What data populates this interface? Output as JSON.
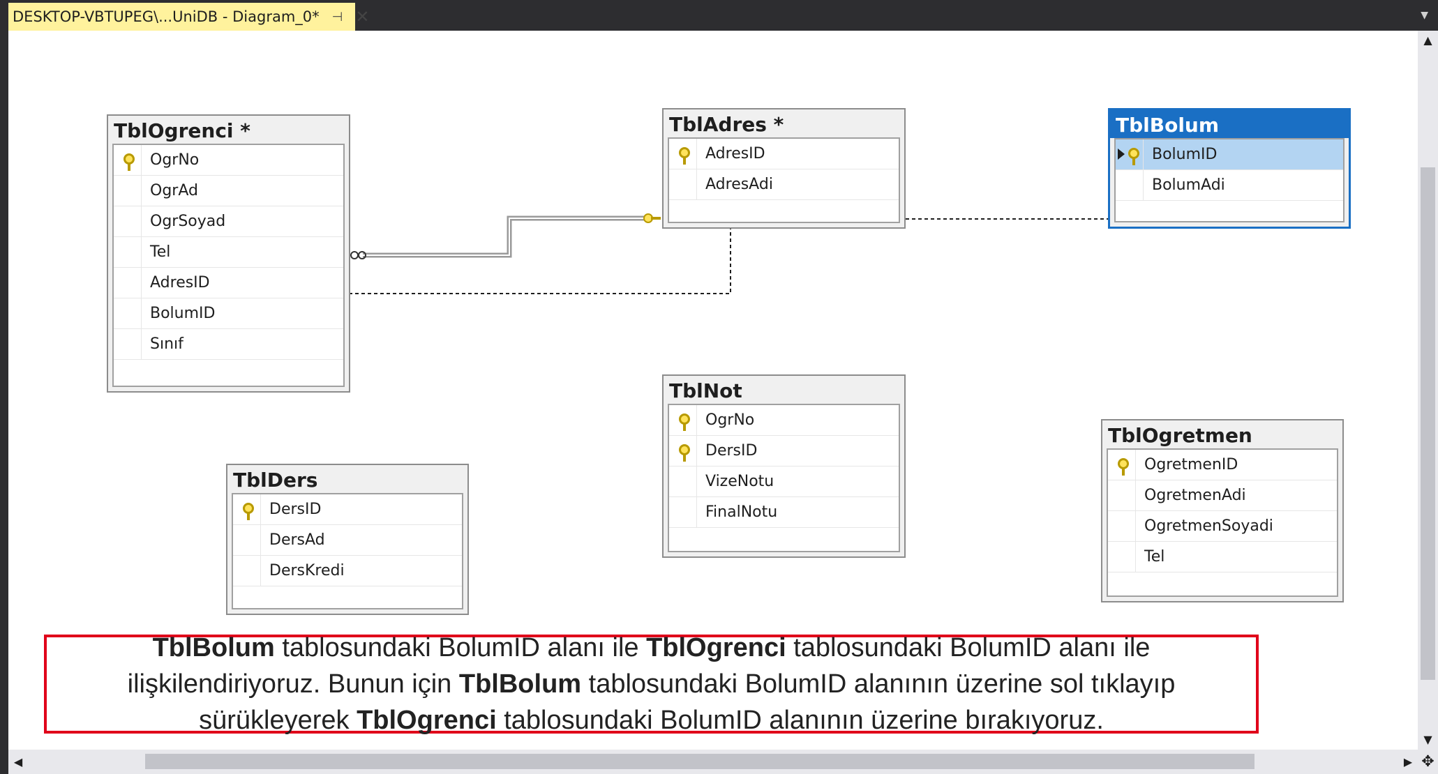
{
  "document_tab": {
    "title": "DESKTOP-VBTUPEG\\...UniDB - Diagram_0*",
    "pin_icon": "pin-icon",
    "close_icon": "close-icon",
    "accent": "#fff29d"
  },
  "tables": {
    "ogrenci": {
      "title": "TblOgrenci *",
      "columns": [
        "OgrNo",
        "OgrAd",
        "OgrSoyad",
        "Tel",
        "AdresID",
        "BolumID",
        "Sınıf"
      ],
      "keys": [
        "OgrNo"
      ]
    },
    "adres": {
      "title": "TblAdres *",
      "columns": [
        "AdresID",
        "AdresAdi"
      ],
      "keys": [
        "AdresID"
      ]
    },
    "bolum": {
      "title": "TblBolum",
      "columns": [
        "BolumID",
        "BolumAdi"
      ],
      "keys": [
        "BolumID"
      ],
      "selected": true,
      "selected_color": "#1a6fc4"
    },
    "not": {
      "title": "TblNot",
      "columns": [
        "OgrNo",
        "DersID",
        "VizeNotu",
        "FinalNotu"
      ],
      "keys": [
        "OgrNo",
        "DersID"
      ]
    },
    "ders": {
      "title": "TblDers",
      "columns": [
        "DersID",
        "DersAd",
        "DersKredi"
      ],
      "keys": [
        "DersID"
      ]
    },
    "ogretmen": {
      "title": "TblOgretmen",
      "columns": [
        "OgretmenID",
        "OgretmenAdi",
        "OgretmenSoyadi",
        "Tel"
      ],
      "keys": [
        "OgretmenID"
      ]
    }
  },
  "note": {
    "s1": "TblBolum",
    "s2": " tablosundaki BolumID alanı ile ",
    "s3": "TblOgrenci",
    "s4": " tablosundaki BolumID alanı ile ilişkilendiriyoruz. Bunun için ",
    "s5": "TblBolum",
    "s6": " tablosundaki BolumID alanının üzerine sol tıklayıp sürükleyerek ",
    "s7": "TblOgrenci",
    "s8": " tablosundaki BolumID alanının üzerine bırakıyoruz.",
    "border_color": "#e0001a"
  },
  "scrollbars": {
    "up_icon": "arrow-up-icon",
    "down_icon": "arrow-down-icon",
    "left_icon": "arrow-left-icon",
    "right_icon": "arrow-right-icon",
    "pan_icon": "pan-icon"
  }
}
